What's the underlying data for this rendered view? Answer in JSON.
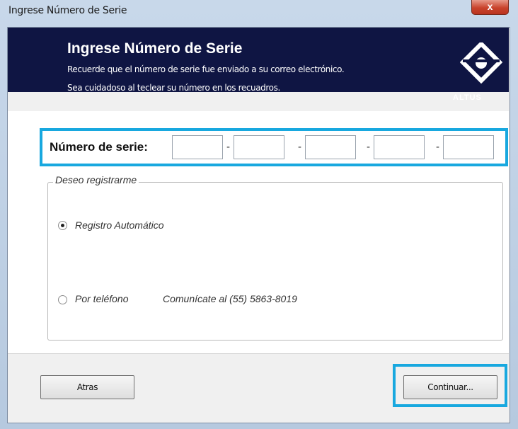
{
  "window": {
    "title": "Ingrese Número de Serie",
    "close_label": "x"
  },
  "banner": {
    "title": "Ingrese Número de Serie",
    "line1": "Recuerde que el número de serie fue enviado a su correo electrónico.",
    "line2": "Sea cuidadoso al teclear su número en los recuadros.",
    "logo_text": "ALTUS"
  },
  "serial": {
    "label": "Número de serie:",
    "segments": [
      "",
      "",
      "",
      "",
      "",
      ""
    ],
    "separator": "-"
  },
  "register": {
    "legend": "Deseo registrarme",
    "options": [
      {
        "label": "Registro Automático",
        "selected": true
      },
      {
        "label": "Por teléfono",
        "selected": false,
        "note": "Comunícate al (55) 5863-8019"
      }
    ]
  },
  "footer": {
    "back_label": "Atras",
    "continue_label": "Continuar..."
  },
  "colors": {
    "banner": "#0f1543",
    "highlight": "#18a8df"
  }
}
